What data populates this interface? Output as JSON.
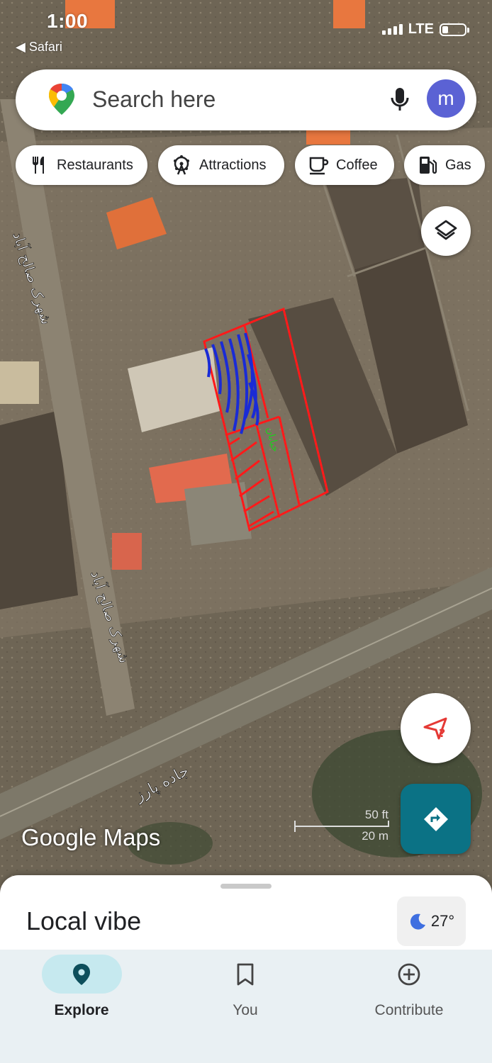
{
  "status_bar": {
    "time": "1:00",
    "back_label": "◀ Safari",
    "network": "LTE"
  },
  "search": {
    "placeholder": "Search here",
    "avatar_letter": "m"
  },
  "chips": [
    {
      "label": "Restaurants",
      "icon": "restaurant-icon"
    },
    {
      "label": "Attractions",
      "icon": "ferris-wheel-icon"
    },
    {
      "label": "Coffee",
      "icon": "coffee-icon"
    },
    {
      "label": "Gas",
      "icon": "gas-pump-icon"
    }
  ],
  "map": {
    "street_label_1": "شهرک صالح آباد",
    "street_label_2": "شهرک صالح آباد",
    "road_label": "جاده پارز",
    "handwritten_note": "خیابان",
    "logo": "Google Maps",
    "scale_ft": "50 ft",
    "scale_m": "20 m"
  },
  "sheet": {
    "title": "Local vibe",
    "temperature": "27°"
  },
  "bottom_nav": [
    {
      "label": "Explore",
      "active": true
    },
    {
      "label": "You",
      "active": false
    },
    {
      "label": "Contribute",
      "active": false
    }
  ],
  "colors": {
    "accent": "#0b7285",
    "avatar": "#5b62d4",
    "nav_active_pill": "#c6e9ef",
    "plot_outline": "#ff1a1a",
    "hatch_blue": "#1a2bd6"
  }
}
